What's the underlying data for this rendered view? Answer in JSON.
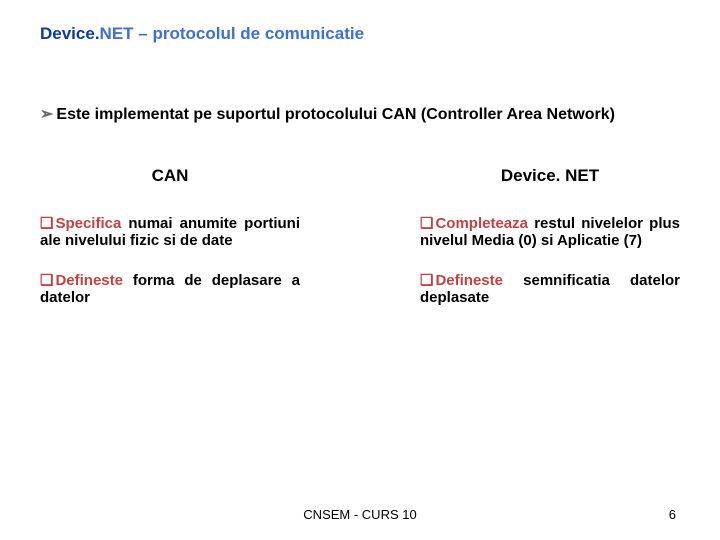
{
  "title": {
    "part1": "Device.",
    "part2": "NET – protocolul de comunicatie"
  },
  "intro": {
    "arrow": "➢",
    "text": "Este implementat pe suportul protocolului CAN (Controller Area Network)"
  },
  "left": {
    "heading": "CAN",
    "items": [
      {
        "marker": "❑",
        "lead": "Specifica",
        "rest": " numai anumite portiuni ale nivelului fizic si de date"
      },
      {
        "marker": "❑",
        "lead": "Defineste",
        "rest": " forma de deplasare a datelor"
      }
    ]
  },
  "right": {
    "heading": "Device. NET",
    "items": [
      {
        "marker": "❑",
        "lead": "Completeaza",
        "rest": " restul nivelelor plus nivelul Media (0) si Aplicatie (7)"
      },
      {
        "marker": "❑",
        "lead": "Defineste",
        "rest": " semnificatia datelor deplasate"
      }
    ]
  },
  "footer": {
    "center": "CNSEM - CURS 10",
    "page": "6"
  }
}
